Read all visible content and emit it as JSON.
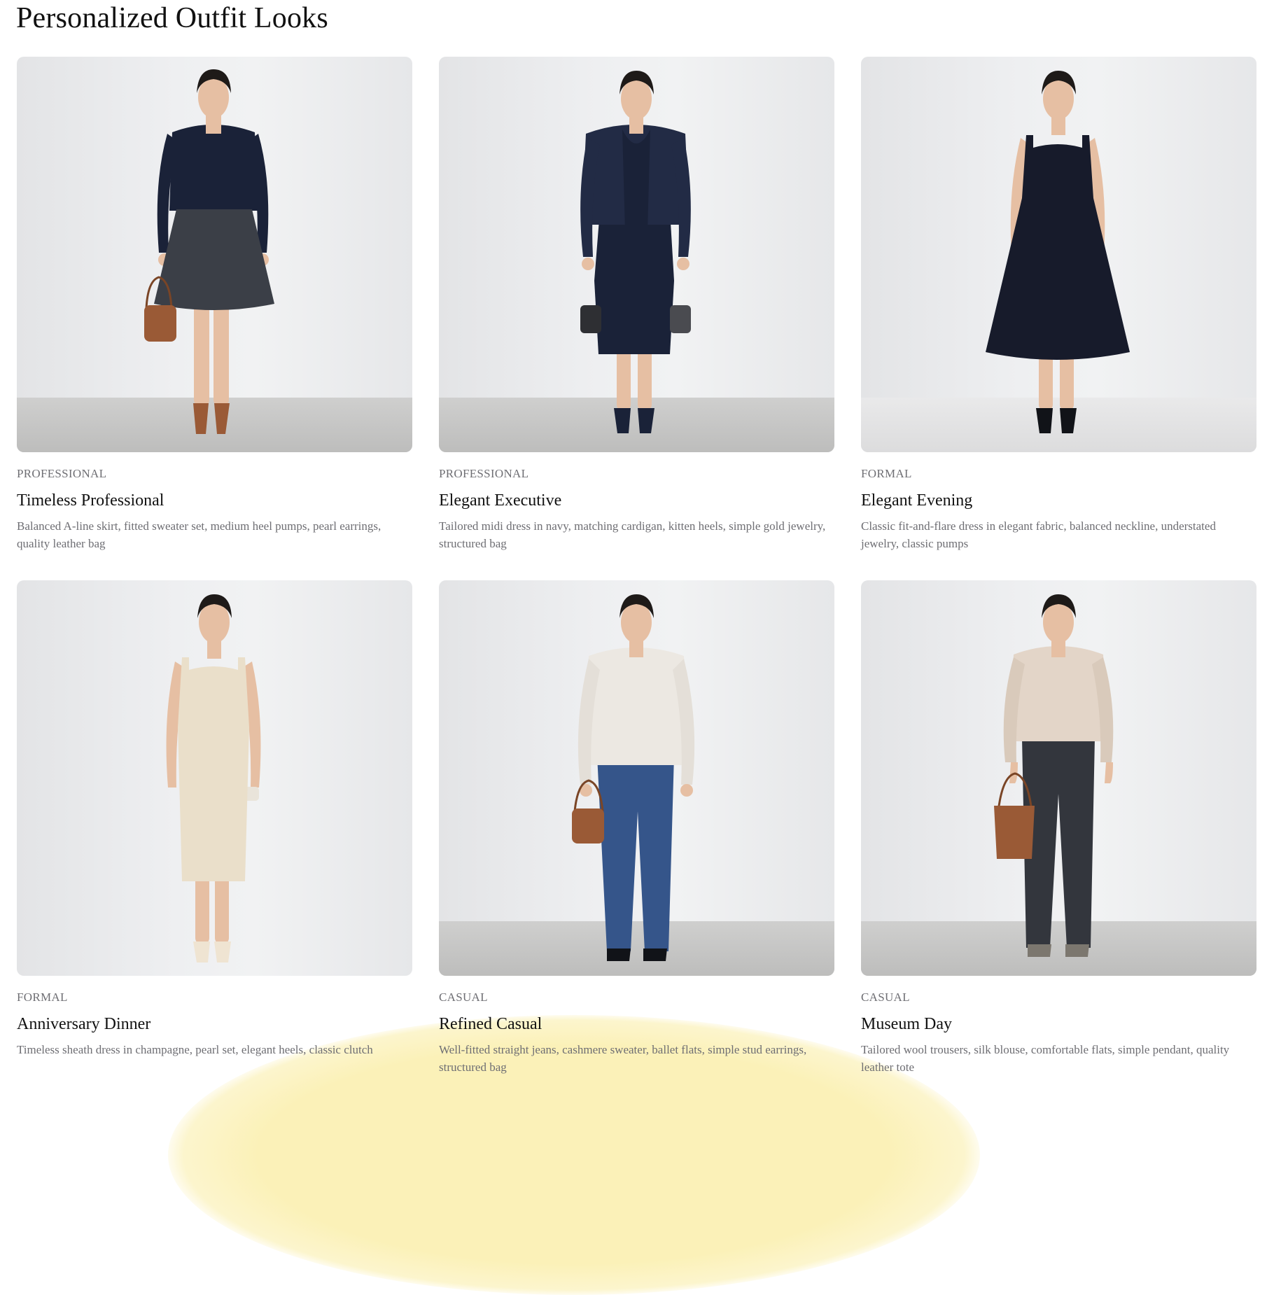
{
  "page": {
    "title": "Personalized Outfit Looks"
  },
  "looks": [
    {
      "category": "PROFESSIONAL",
      "title": "Timeless Professional",
      "description": "Balanced A-line skirt, fitted sweater set, medium heel pumps, pearl earrings, quality leather bag"
    },
    {
      "category": "PROFESSIONAL",
      "title": "Elegant Executive",
      "description": "Tailored midi dress in navy, matching cardigan, kitten heels, simple gold jewelry, structured bag"
    },
    {
      "category": "FORMAL",
      "title": "Elegant Evening",
      "description": "Classic fit-and-flare dress in elegant fabric, balanced neckline, understated jewelry, classic pumps"
    },
    {
      "category": "FORMAL",
      "title": "Anniversary Dinner",
      "description": "Timeless sheath dress in champagne, pearl set, elegant heels, classic clutch"
    },
    {
      "category": "CASUAL",
      "title": "Refined Casual",
      "description": "Well-fitted straight jeans, cashmere sweater, ballet flats, simple stud earrings, structured bag"
    },
    {
      "category": "CASUAL",
      "title": "Museum Day",
      "description": "Tailored wool trousers, silk blouse, comfortable flats, simple pendant, quality leather tote"
    }
  ],
  "colors": {
    "navy": "#1a2238",
    "charcoal": "#3b3f47",
    "champagne": "#eadfca",
    "denim": "#35558a",
    "cream": "#ece8e2",
    "satin": "#e3d5c8",
    "cognac": "#9a5a36",
    "skin": "#e6bfa3",
    "hair": "#1e1a18",
    "highlight": "#fbf1b8"
  }
}
